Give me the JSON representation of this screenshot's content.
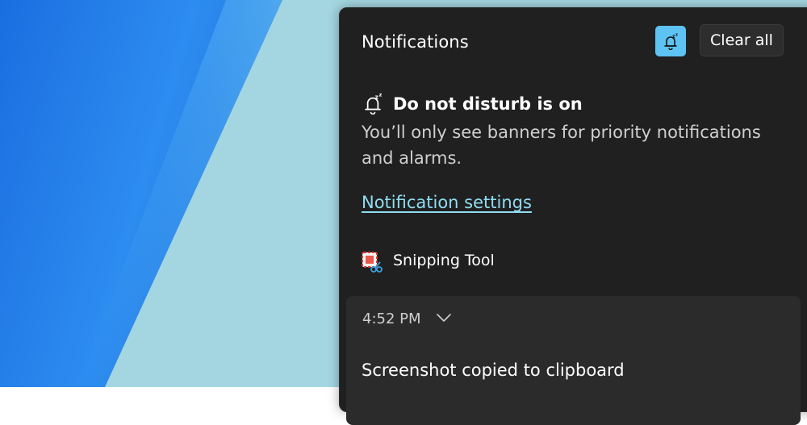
{
  "panel": {
    "title": "Notifications",
    "clear_all_label": "Clear all",
    "dnd_toggle_icon": "bell-snooze-icon",
    "dnd_toggle_state": "on",
    "accent": "#5cc3f2",
    "background": "#202020"
  },
  "dnd": {
    "icon": "bell-snooze-icon",
    "heading": "Do not disturb is on",
    "description": "You’ll only see banners for priority notifications and alarms."
  },
  "settings_link": {
    "label": "Notification settings",
    "color": "#8fdcf0"
  },
  "app_group": {
    "icon": "snipping-tool-icon",
    "name": "Snipping Tool"
  },
  "notification": {
    "time": "4:52 PM",
    "expand_icon": "chevron-down-icon",
    "message": "Screenshot copied to clipboard"
  }
}
